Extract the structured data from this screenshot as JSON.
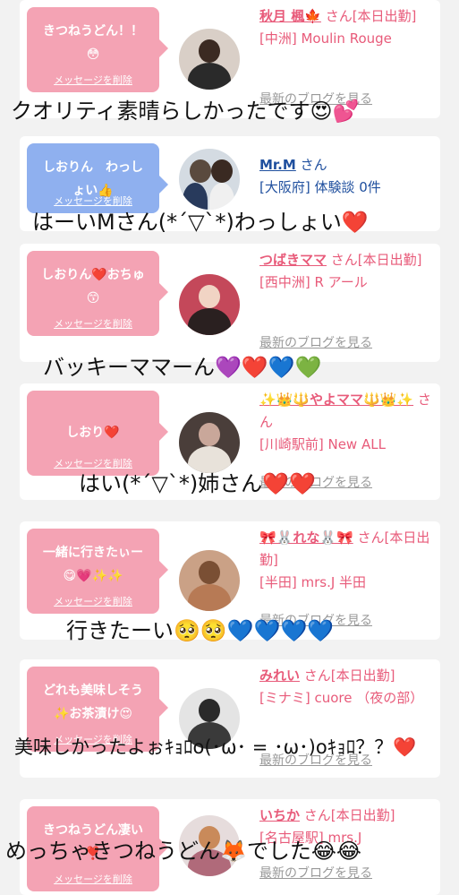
{
  "cards": [
    {
      "bubble": [
        "きつねうどん！！",
        "😳"
      ],
      "bubble_color": "#f4a3b4",
      "delete": "メッセージを削除",
      "name": "秋月 楓🍁",
      "san": "さん[本日出勤]",
      "area": "[中洲] Moulin Rouge",
      "blog": "最新のブログを見る"
    },
    {
      "bubble": [
        "しおりん　わっし",
        "ょい👍"
      ],
      "bubble_color": "#8fb0ef",
      "delete": "メッセージを削除",
      "name": "Mr.M",
      "san": "さん",
      "area": "[大阪府] 体験談 0件",
      "blog": ""
    },
    {
      "bubble": [
        "しおりん❤️おちゅ",
        "😙"
      ],
      "bubble_color": "#f4a3b4",
      "delete": "メッセージを削除",
      "name": "つばきママ",
      "san": "さん[本日出勤]",
      "area": "[西中洲] R アール",
      "blog": "最新のブログを見る"
    },
    {
      "bubble": [
        "しおり❤️",
        ""
      ],
      "bubble_color": "#f4a3b4",
      "delete": "メッセージを削除",
      "name": "✨👑🔱やよママ🔱👑✨",
      "san": "さん",
      "area": "[川崎駅前] New ALL",
      "blog": "最新のブログを見る"
    },
    {
      "bubble": [
        "一緒に行きたぃー",
        "😋💗✨✨"
      ],
      "bubble_color": "#f4a3b4",
      "delete": "メッセージを削除",
      "name": "🎀🐰れな🐰🎀",
      "san": "さん[本日出勤]",
      "area": "[半田] mrs.J 半田",
      "blog": "最新のブログを見る"
    },
    {
      "bubble": [
        "どれも美味しそう",
        "✨お茶漬け😍"
      ],
      "bubble_color": "#f4a3b4",
      "delete": "メッセージを削除",
      "name": "みれい",
      "san": "さん[本日出勤]",
      "area": "[ミナミ] cuore （夜の部）",
      "blog": "最新のブログを見る"
    },
    {
      "bubble": [
        "きつねうどん凄い",
        "❣️"
      ],
      "bubble_color": "#f4a3b4",
      "delete": "メッセージを削除",
      "name": "いちか",
      "san": "さん[本日出勤]",
      "area": "[名古屋駅] mrs.J",
      "blog": "最新のブログを見る"
    }
  ],
  "comments": [
    "クオリティ素晴らしかったです😍💕",
    "はーいMさん(*´▽`*)わっしょい❤️",
    "バッキーママーん💜❤️💙💚",
    "はい(*´▽`*)姉さん❤️❤️",
    "行きたーい🥺🥺💙💙💙💙",
    "美味しかったよぉｷｮﾛo(･ω･ = ･ω･)oｷｮﾛ？？❤️",
    "めっちゃきつねうどん🦊でした😂😂"
  ],
  "colors": {
    "accent": "#e85b7a",
    "bubble_pink": "#f4a3b4",
    "bubble_blue": "#8fb0ef",
    "link_gray": "#999999"
  }
}
